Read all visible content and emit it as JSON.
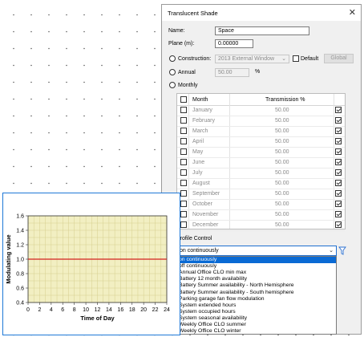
{
  "dialog": {
    "title": "Translucent Shade",
    "close_glyph": "✕",
    "name_label": "Name:",
    "name_value": "Space",
    "plane_label": "Plane (m):",
    "plane_value": "0.00000",
    "construction_label": "Construction:",
    "construction_value": "2013 External Window",
    "default_label": "Default",
    "global_label": "Global",
    "annual_label": "Annual",
    "annual_value": "50.00",
    "annual_unit": "%",
    "monthly_label": "Monthly",
    "selected_mode": "Monthly",
    "grid": {
      "col_month": "Month",
      "col_transmission": "Transmission %",
      "rows": [
        {
          "month": "January",
          "value": "50.00"
        },
        {
          "month": "February",
          "value": "50.00"
        },
        {
          "month": "March",
          "value": "50.00"
        },
        {
          "month": "April",
          "value": "50.00"
        },
        {
          "month": "May",
          "value": "50.00"
        },
        {
          "month": "June",
          "value": "50.00"
        },
        {
          "month": "July",
          "value": "50.00"
        },
        {
          "month": "August",
          "value": "50.00"
        },
        {
          "month": "September",
          "value": "50.00"
        },
        {
          "month": "October",
          "value": "50.00"
        },
        {
          "month": "November",
          "value": "50.00"
        },
        {
          "month": "December",
          "value": "50.00"
        }
      ]
    },
    "profile_control_label": "Profile Control",
    "profile_value": "on continuously",
    "profile_options": [
      "on continuously",
      "off continuously",
      "Annual Office CLO min max",
      "Battery 12 month availability",
      "Battery Summer availability - North Hemisphere",
      "Battery Summer availability - South hemisphere",
      "Parking garage fan flow modulation",
      "System extended hours",
      "System occupied hours",
      "System seasonal availability",
      "Weekly Office CLO summer",
      "Weekly Office CLO winter"
    ]
  },
  "chart_data": {
    "type": "line",
    "xlabel": "Time of Day",
    "ylabel": "Modulating value",
    "xlim": [
      0,
      24
    ],
    "ylim": [
      0.4,
      1.6
    ],
    "x_ticks": [
      0,
      2,
      4,
      6,
      8,
      10,
      12,
      14,
      16,
      18,
      20,
      22,
      24
    ],
    "y_ticks": [
      "0.4",
      "0.6",
      "0.8",
      "1.0",
      "1.2",
      "1.4",
      "1.6"
    ],
    "grid": true,
    "series": [
      {
        "x": [
          0,
          24
        ],
        "values": [
          1.0,
          1.0
        ],
        "color": "#d42020"
      }
    ],
    "colors": {
      "plot_bg": "#f2efc2",
      "grid": "#d6cf8f"
    }
  }
}
